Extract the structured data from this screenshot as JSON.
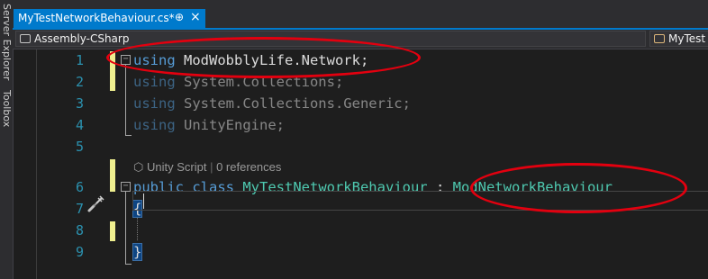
{
  "sidebar": {
    "labels": [
      "Server Explorer",
      "Toolbox"
    ]
  },
  "tab": {
    "title": "MyTestNetworkBehaviour.cs*",
    "pin_glyph": "⊕",
    "close_glyph": "×"
  },
  "navbar": {
    "project": "Assembly-CSharp",
    "class_dropdown": "MyTest"
  },
  "editor": {
    "line_numbers": [
      "1",
      "2",
      "3",
      "4",
      "5",
      "6",
      "7",
      "8",
      "9"
    ],
    "codelens": {
      "unity": "Unity Script",
      "separator": "|",
      "references": "0 references"
    },
    "lines": {
      "l1_kw": "using",
      "l1_rest": " ModWobblyLife.Network;",
      "l2_kw": "using",
      "l2_rest": " System.Collections;",
      "l3_kw": "using",
      "l3_rest": " System.Collections.Generic;",
      "l4_kw": "using",
      "l4_rest": " UnityEngine;",
      "l6_kw1": "public",
      "l6_kw2": " class ",
      "l6_name": "MyTestNetworkBehaviour",
      "l6_colon": " : ",
      "l6_base": "ModNetworkBehaviour",
      "l7": "{",
      "l9": "}"
    },
    "fold_glyph": "−"
  },
  "colors": {
    "tab_active": "#007acc",
    "keyword": "#569cd6",
    "type": "#4ec9b0",
    "annotation": "#e3000f",
    "line_number": "#2b91af"
  }
}
